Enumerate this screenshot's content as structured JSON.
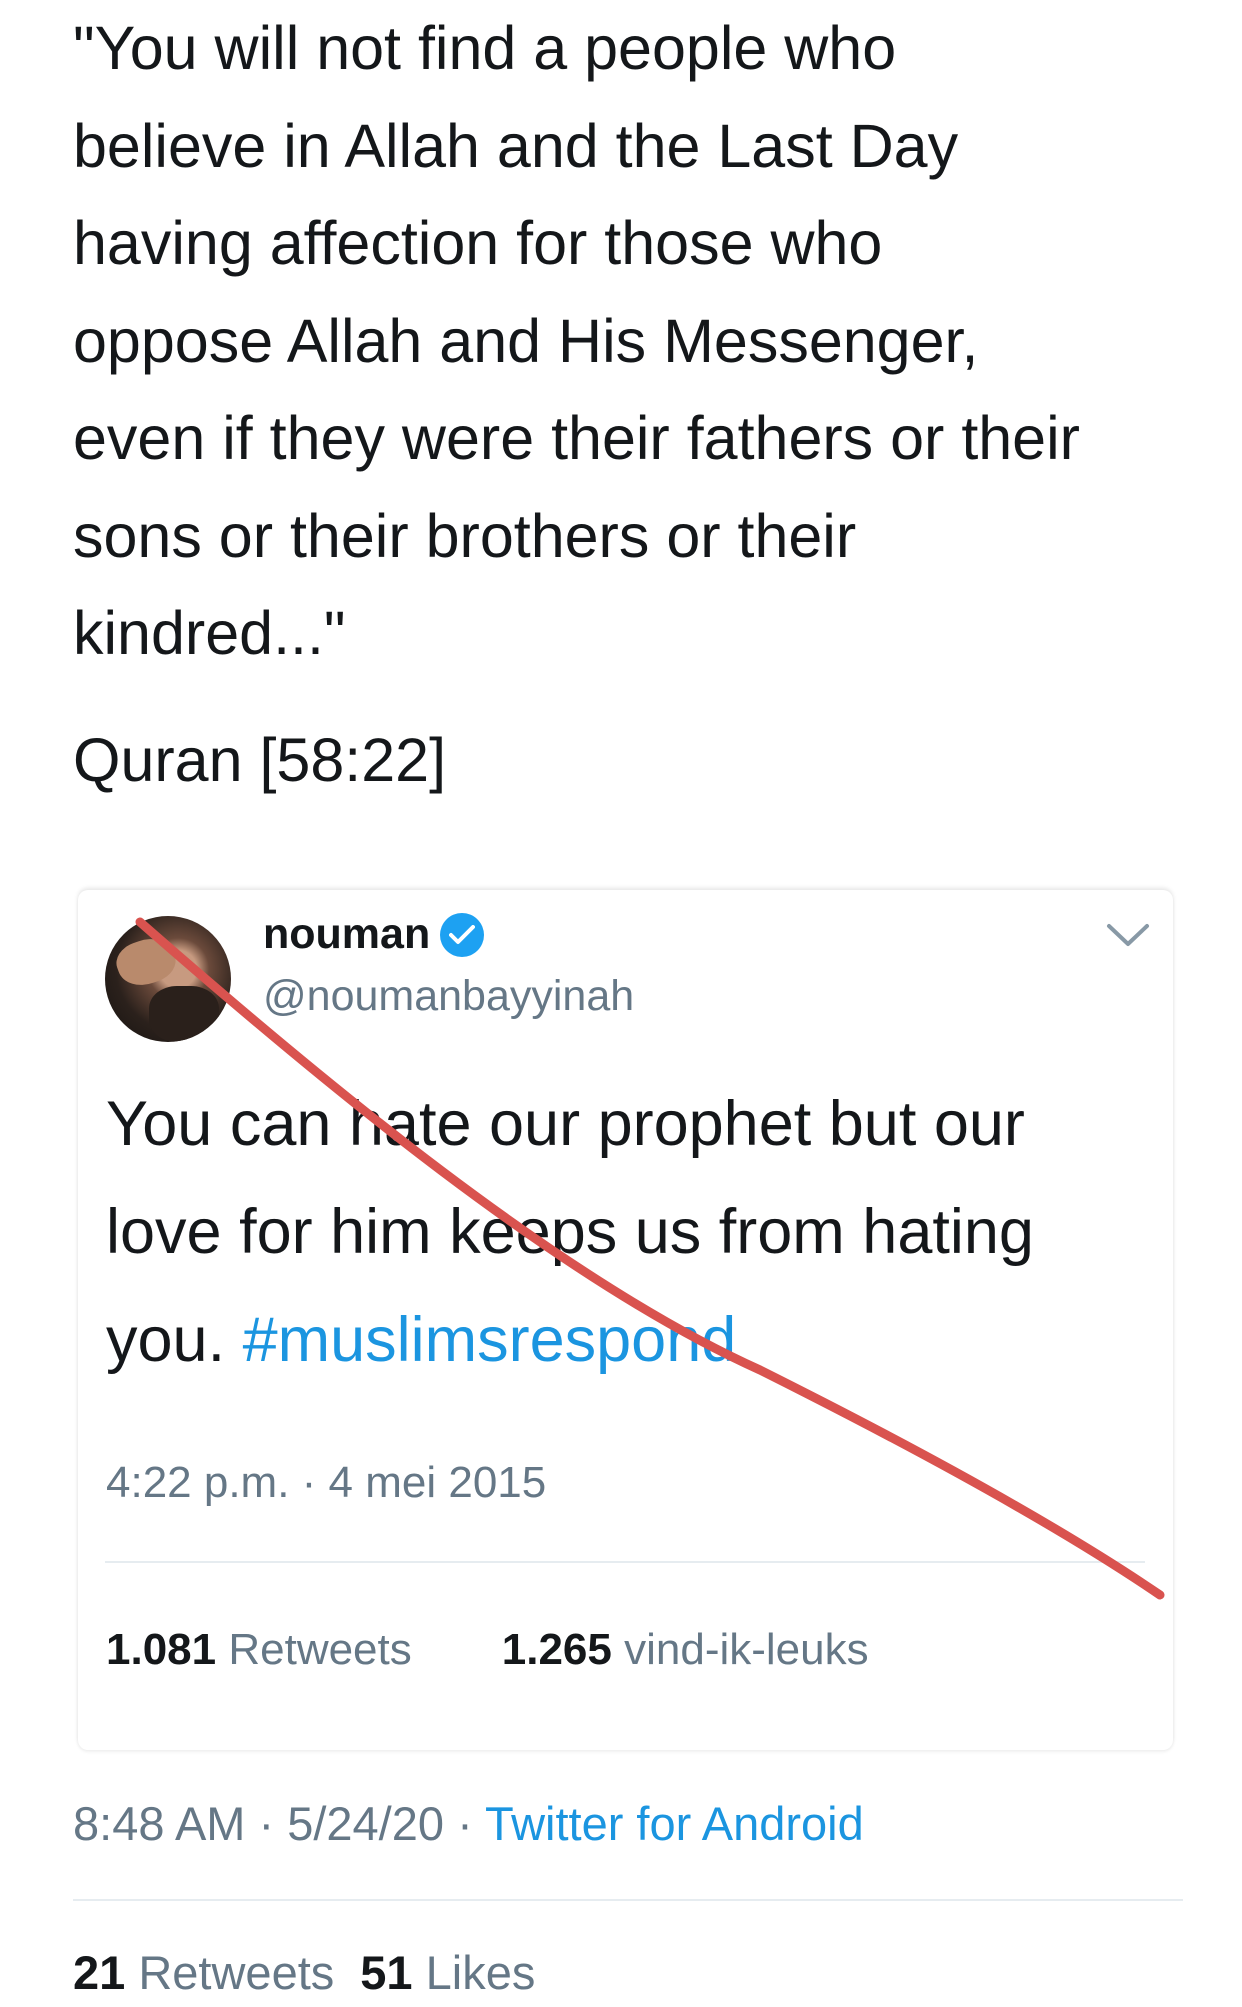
{
  "quote": {
    "lines": [
      "\"You will not find a people who",
      "believe in Allah and the Last Day",
      "having affection for those who",
      "oppose Allah and His Messenger,",
      "even if they were their fathers or their",
      "sons or their brothers or their",
      "kindred...\""
    ],
    "source": "Quran [58:22]"
  },
  "embedded_tweet": {
    "name": "nouman",
    "handle": "@noumanbayyinah",
    "text_lines": [
      "You can hate our prophet but our",
      "love for him keeps us from hating"
    ],
    "text_last_prefix": "you. ",
    "hashtag": "#muslimsrespond",
    "timestamp": "4:22 p.m. · 4 mei 2015",
    "retweets_count": "1.081",
    "retweets_label": "Retweets",
    "likes_count": "1.265",
    "likes_label": "vind-ik-leuks",
    "accent_color": "#1b95e0",
    "verified_icon": "verified-badge-icon",
    "menu_icon": "chevron-down-icon",
    "annotation_color": "#d9534f"
  },
  "tweet_meta": {
    "time_date": "8:48 AM · 5/24/20 · ",
    "source": "Twitter for Android"
  },
  "tweet_stats": {
    "retweets_count": "21",
    "retweets_label": "Retweets",
    "likes_count": "51",
    "likes_label": "Likes"
  }
}
